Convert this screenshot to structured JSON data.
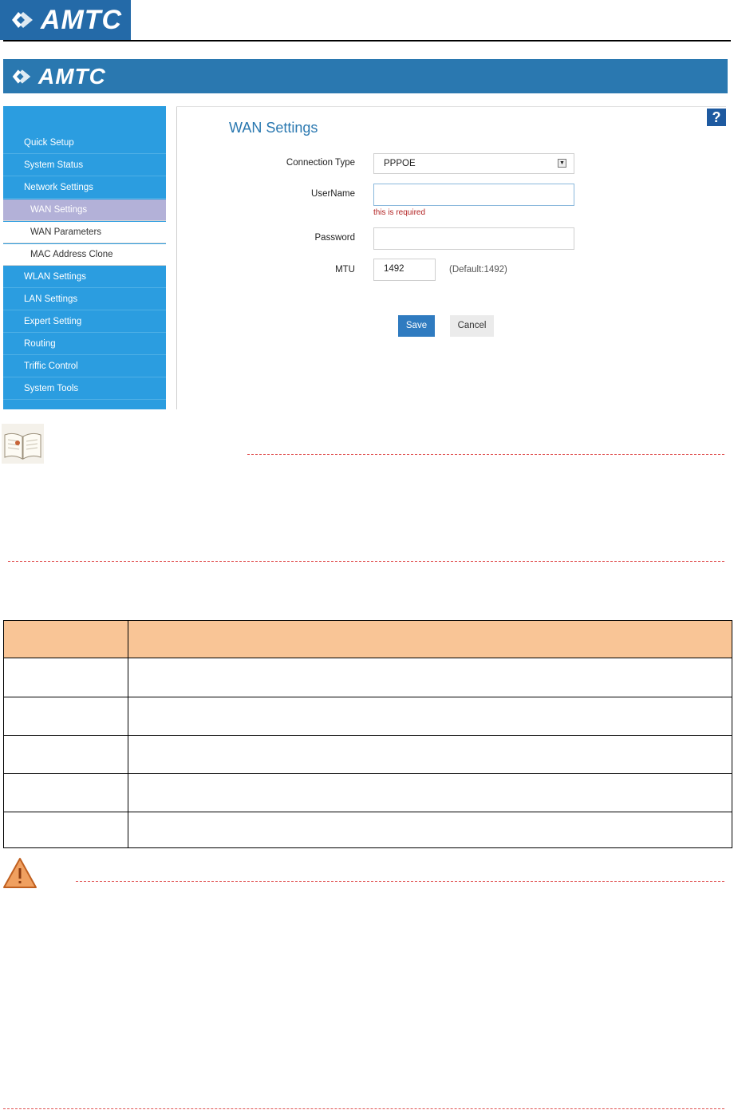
{
  "document": {
    "brand": "AMTC"
  },
  "router_ui": {
    "brand": "AMTC",
    "sidebar": {
      "items": [
        {
          "label": "Quick Setup",
          "type": "main"
        },
        {
          "label": "System Status",
          "type": "main"
        },
        {
          "label": "Network Settings",
          "type": "main"
        },
        {
          "label": "WAN Settings",
          "type": "sub-active"
        },
        {
          "label": "WAN Parameters",
          "type": "sub"
        },
        {
          "label": "MAC Address Clone",
          "type": "sub"
        },
        {
          "label": "WLAN Settings",
          "type": "main"
        },
        {
          "label": "LAN Settings",
          "type": "main"
        },
        {
          "label": "Expert Setting",
          "type": "main"
        },
        {
          "label": "Routing",
          "type": "main"
        },
        {
          "label": "Triffic Control",
          "type": "main"
        },
        {
          "label": "System Tools",
          "type": "main"
        }
      ]
    },
    "help_icon": "?",
    "page_title": "WAN Settings",
    "form": {
      "connection_type": {
        "label": "Connection Type",
        "value": "PPPOE"
      },
      "username": {
        "label": "UserName",
        "value": "",
        "error": "this is required"
      },
      "password": {
        "label": "Password",
        "value": ""
      },
      "mtu": {
        "label": "MTU",
        "value": "1492",
        "hint": "(Default:1492)"
      }
    },
    "buttons": {
      "save": "Save",
      "cancel": "Cancel"
    }
  },
  "icons": {
    "note": "open-book-icon",
    "warning": "warning-triangle-icon"
  },
  "colors": {
    "brand_blue": "#246aa8",
    "sidebar_blue": "#2b9de0",
    "active_item": "#b3b1d8",
    "save_button": "#2f7bc0",
    "table_header": "#f9c596",
    "error": "#b22222"
  }
}
